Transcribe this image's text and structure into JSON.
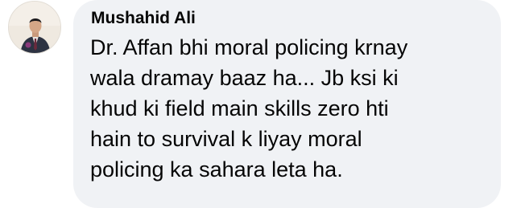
{
  "comment": {
    "author": "Mushahid Ali",
    "avatar_icon": "profile-photo",
    "text_lines": [
      "Dr. Affan bhi moral policing krnay",
      "wala dramay baaz ha... Jb ksi ki",
      "khud ki field main skills zero hti",
      "hain to survival k liyay moral",
      "policing ka sahara leta ha."
    ]
  },
  "colors": {
    "bubble_background": "#f0f2f5",
    "text": "#050505"
  }
}
